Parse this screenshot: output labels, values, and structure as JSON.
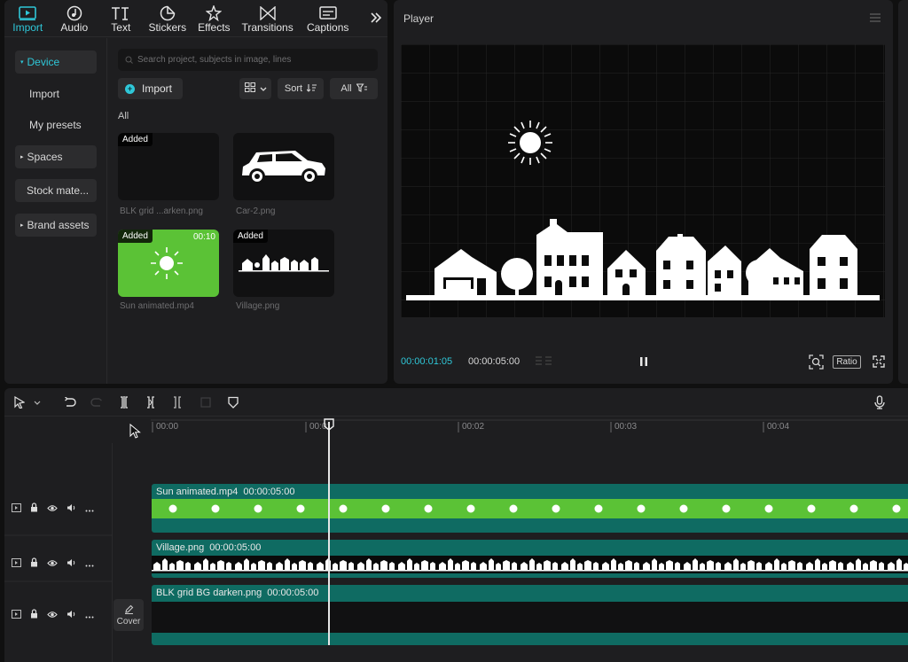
{
  "toolbar": {
    "tabs": [
      {
        "label": "Import",
        "icon": "import-icon",
        "active": true
      },
      {
        "label": "Audio",
        "icon": "audio-icon"
      },
      {
        "label": "Text",
        "icon": "text-icon"
      },
      {
        "label": "Stickers",
        "icon": "stickers-icon"
      },
      {
        "label": "Effects",
        "icon": "effects-icon"
      },
      {
        "label": "Transitions",
        "icon": "transitions-icon"
      },
      {
        "label": "Captions",
        "icon": "captions-icon"
      }
    ],
    "more_icon": "double-chevron-right-icon"
  },
  "sidebar": {
    "items": [
      {
        "label": "Device",
        "caret": "▾"
      },
      {
        "label": "Import"
      },
      {
        "label": "My presets"
      },
      {
        "label": "Spaces",
        "caret": "▸"
      },
      {
        "label": "Stock mate..."
      },
      {
        "label": "Brand assets",
        "caret": "▸"
      }
    ]
  },
  "media": {
    "search_placeholder": "Search project, subjects in image, lines",
    "import_label": "Import",
    "sort_label": "Sort",
    "filter_label": "All",
    "section_label": "All",
    "items": [
      {
        "name": "BLK grid ...arken.png",
        "badge": "Added",
        "duration": ""
      },
      {
        "name": "Car-2.png",
        "badge": "",
        "duration": ""
      },
      {
        "name": "Sun animated.mp4",
        "badge": "Added",
        "duration": "00:10"
      },
      {
        "name": "Village.png",
        "badge": "Added",
        "duration": ""
      }
    ]
  },
  "player": {
    "title": "Player",
    "current_time": "00:00:01:05",
    "total_time": "00:00:05:00",
    "ratio_label": "Ratio"
  },
  "timeline": {
    "ruler": [
      "00:00",
      "00:01",
      "00:02",
      "00:03",
      "00:04"
    ],
    "tracks": [
      {
        "clip_name": "Sun animated.mp4",
        "duration": "00:00:05:00"
      },
      {
        "clip_name": "Village.png",
        "duration": "00:00:05:00"
      },
      {
        "clip_name": "BLK grid BG darken.png",
        "duration": "00:00:05:00"
      }
    ],
    "cover_label": "Cover"
  },
  "colors": {
    "accent": "#2fc7d8",
    "video_clip": "#5bc236",
    "clip_band": "#0f6b62",
    "panel": "#1e1e20"
  }
}
